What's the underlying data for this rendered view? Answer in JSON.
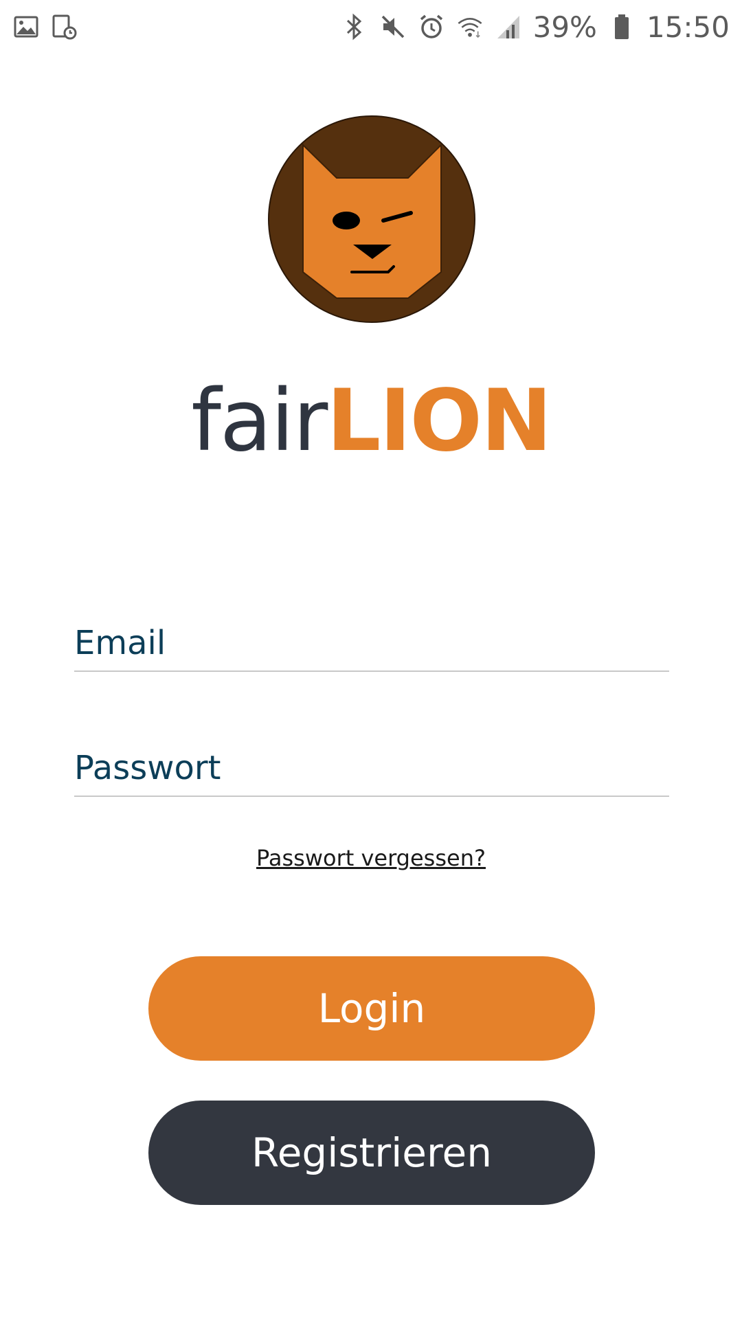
{
  "status_bar": {
    "left_icons": [
      "image-icon",
      "screenshot-schedule-icon"
    ],
    "right_icons": [
      "bluetooth-icon",
      "mute-icon",
      "alarm-icon",
      "wifi-icon",
      "signal-icon",
      "battery-icon"
    ],
    "battery_percent": "39%",
    "time": "15:50"
  },
  "brand": {
    "logo_icon": "winking-lion-logo-icon",
    "name_prefix": "fair",
    "name_suffix": "LION",
    "colors": {
      "primary_dark": "#2f3540",
      "accent_orange": "#e5812a",
      "logo_brown": "#55300e"
    }
  },
  "form": {
    "email_placeholder": "Email",
    "password_placeholder": "Passwort",
    "forgot_password": "Passwort vergessen?",
    "input_text_color": "#0c3e58"
  },
  "actions": {
    "login_label": "Login",
    "register_label": "Registrieren",
    "login_color": "#e5812a",
    "register_color": "#333740"
  }
}
